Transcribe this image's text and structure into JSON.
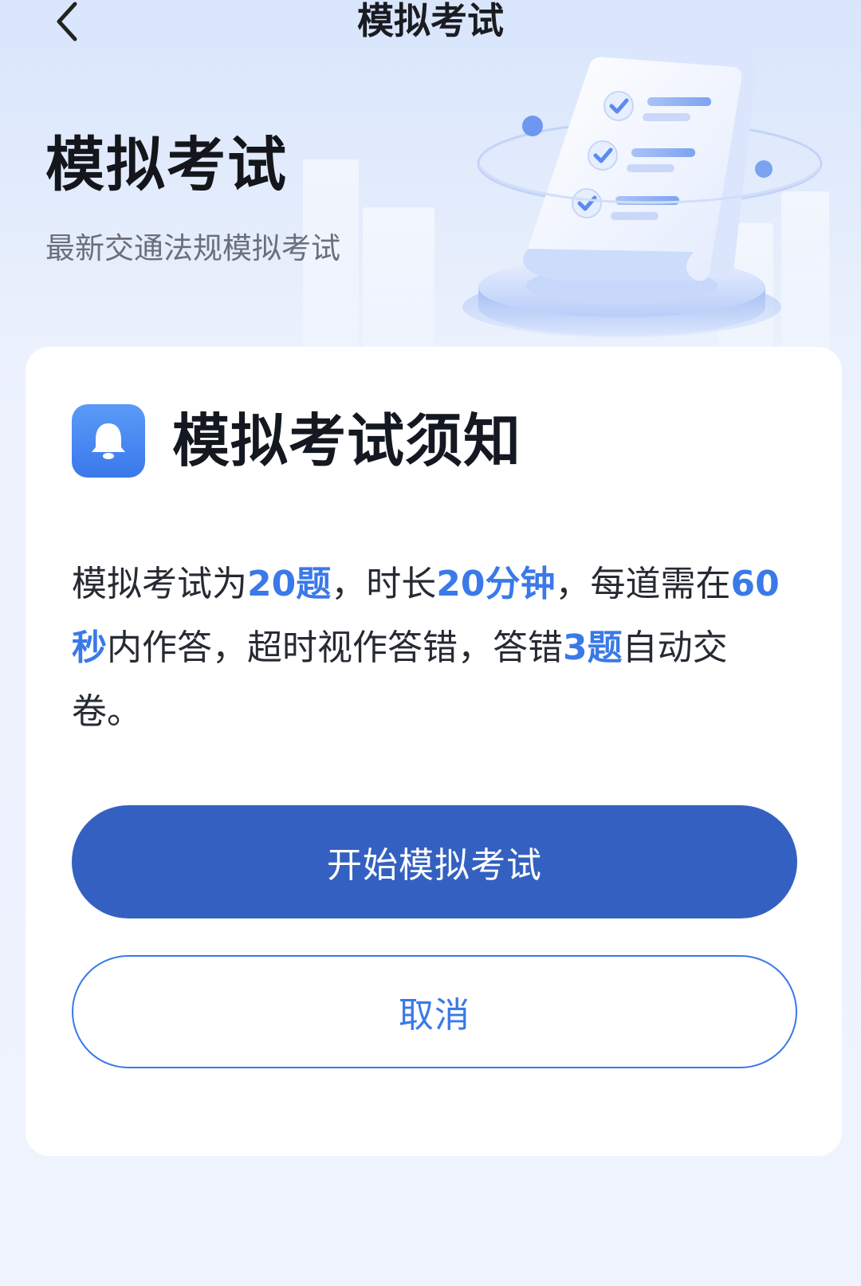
{
  "nav": {
    "title": "模拟考试"
  },
  "hero": {
    "title": "模拟考试",
    "subtitle": "最新交通法规模拟考试"
  },
  "card": {
    "title": "模拟考试须知",
    "notice": {
      "p1": "模拟考试为",
      "h1": "20题",
      "p2": "，时长",
      "h2": "20分钟",
      "p3": "，每道需在",
      "h3": "60秒",
      "p4": "内作答，超时视作答错，答错",
      "h4": "3题",
      "p5": "自动交卷。"
    },
    "start_label": "开始模拟考试",
    "cancel_label": "取消"
  },
  "colors": {
    "accent": "#3a79e8",
    "primary_button": "#3461c1",
    "icon_bg": "#4a8af2"
  },
  "icons": {
    "back": "chevron-left-icon",
    "notice": "bell-icon",
    "illustration": "checklist-document-illustration"
  }
}
